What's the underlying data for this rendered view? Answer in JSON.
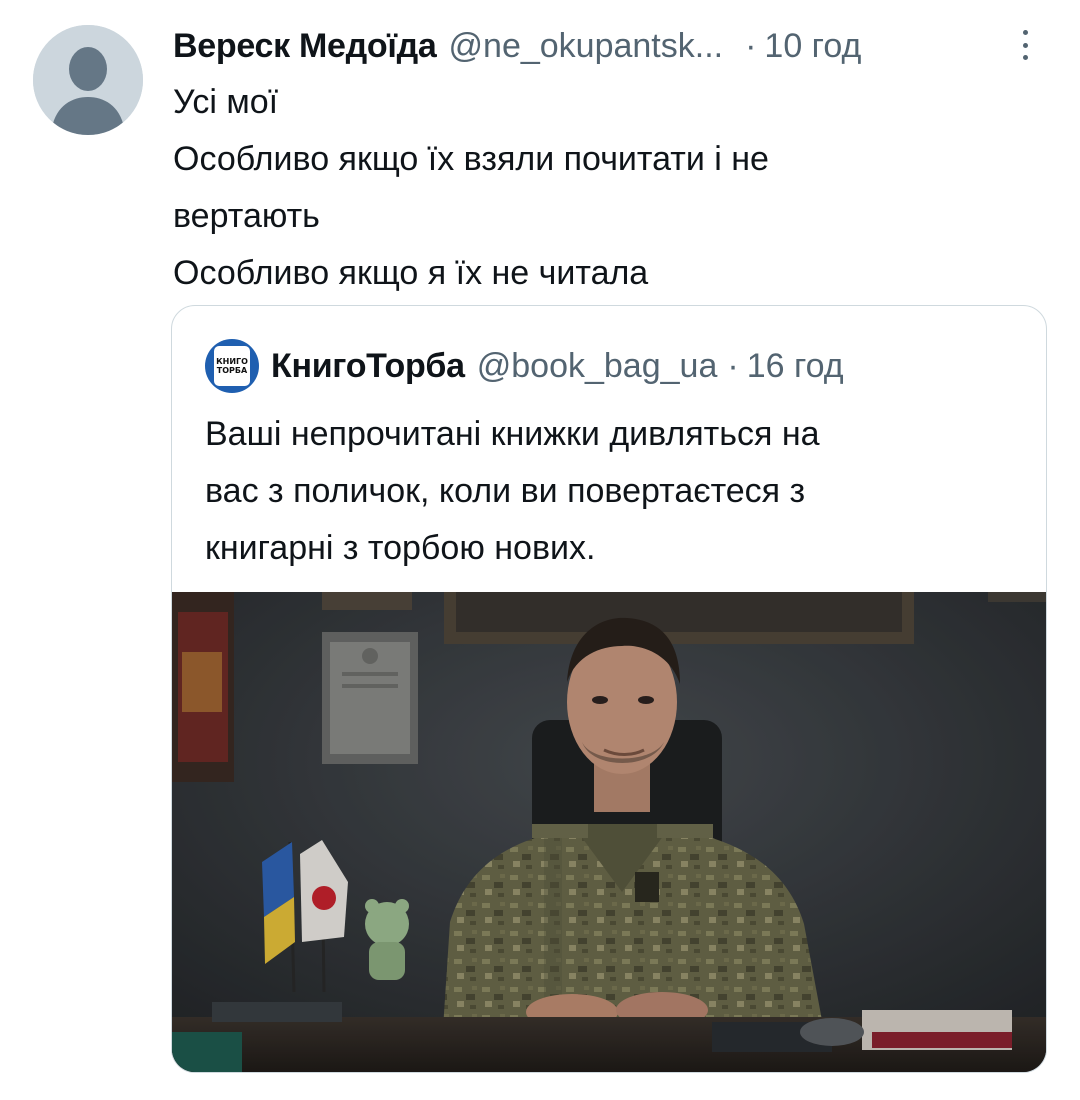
{
  "tweet": {
    "author": {
      "display_name": "Вереск Медоїда",
      "handle": "@ne_okupantsk...",
      "avatar_icon": "default-profile-icon"
    },
    "separator": "·",
    "time": "10 год",
    "more_icon": "more-vertical-icon",
    "text_lines": [
      "Усі мої",
      "Особливо якщо їх взяли почитати і не",
      "вертають",
      "Особливо якщо я їх не читала"
    ]
  },
  "quote": {
    "author": {
      "display_name": "КнигоТорба",
      "handle": "@book_bag_ua",
      "logo_lines": [
        "КНИГО",
        "ТОРБА"
      ]
    },
    "separator": "·",
    "time": "16 год",
    "text_lines": [
      "Ваші непрочитані книжки дивляться на",
      "вас з поличок, коли ви повертаєтеся з",
      "книгарні з торбою нових."
    ],
    "media": {
      "type": "photo"
    }
  },
  "colors": {
    "text": "#0f1419",
    "secondary": "#536471",
    "border": "#cfd9de",
    "avatar_placeholder": "#ccd6dd",
    "logo_blue": "#1f5fb0"
  }
}
